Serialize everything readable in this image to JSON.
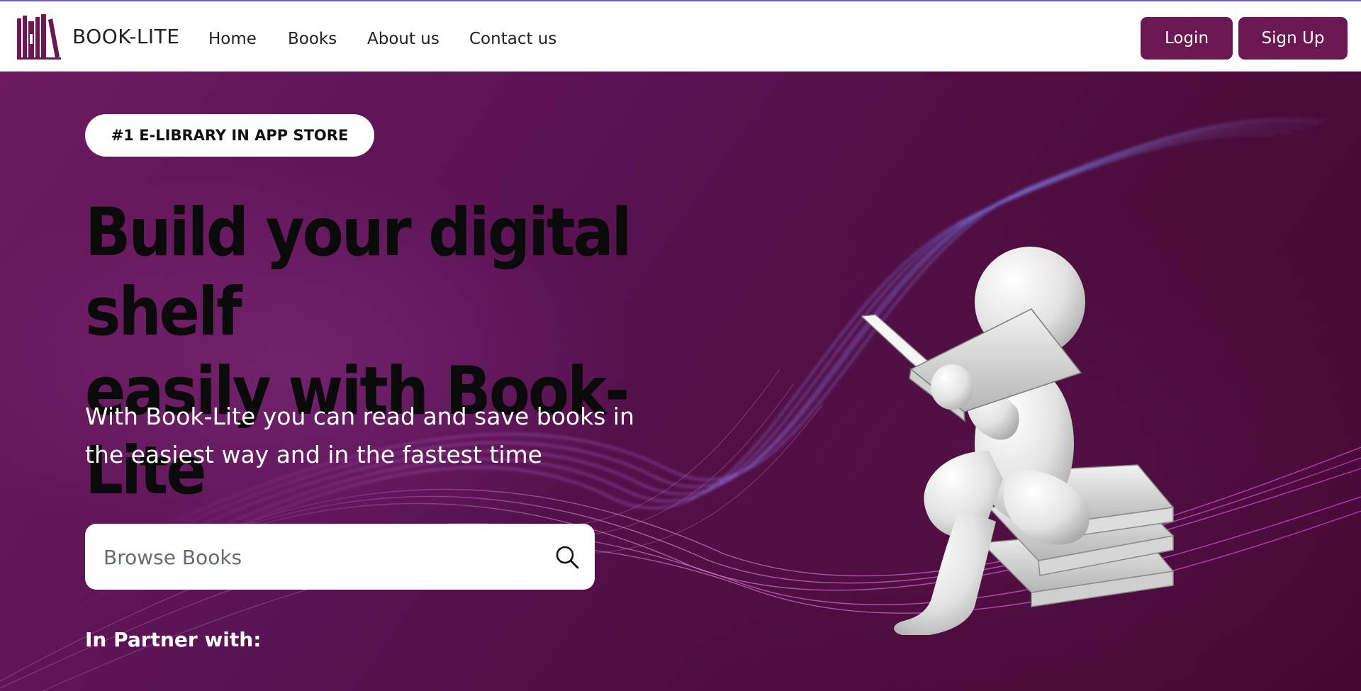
{
  "app": {
    "brand_name": "BOOK-LITE",
    "logo_icon": "bookshelf-icon"
  },
  "nav": {
    "links": [
      {
        "label": "Home"
      },
      {
        "label": "Books"
      },
      {
        "label": "About us"
      },
      {
        "label": "Contact us"
      }
    ],
    "login_label": "Login",
    "signup_label": "Sign Up"
  },
  "hero": {
    "badge": "#1 E-LIBRARY IN APP STORE",
    "headline_line1": "Build your digital shelf",
    "headline_line2": "easily with Book-Lite",
    "subtext_line1": "With Book-Lite you can read and save books in",
    "subtext_line2": "the easiest way and in the fastest time",
    "search": {
      "placeholder": "Browse Books",
      "value": "",
      "icon": "search-icon"
    },
    "partner_label": "In Partner with:",
    "illustration": "figure-reading-book-on-books-stack"
  },
  "colors": {
    "brand": "#6b1752",
    "accent_line": "#6c5fc7",
    "hero_bg": "#5a1354",
    "headline": "#0a0a0a",
    "subtext": "#ffffff"
  }
}
